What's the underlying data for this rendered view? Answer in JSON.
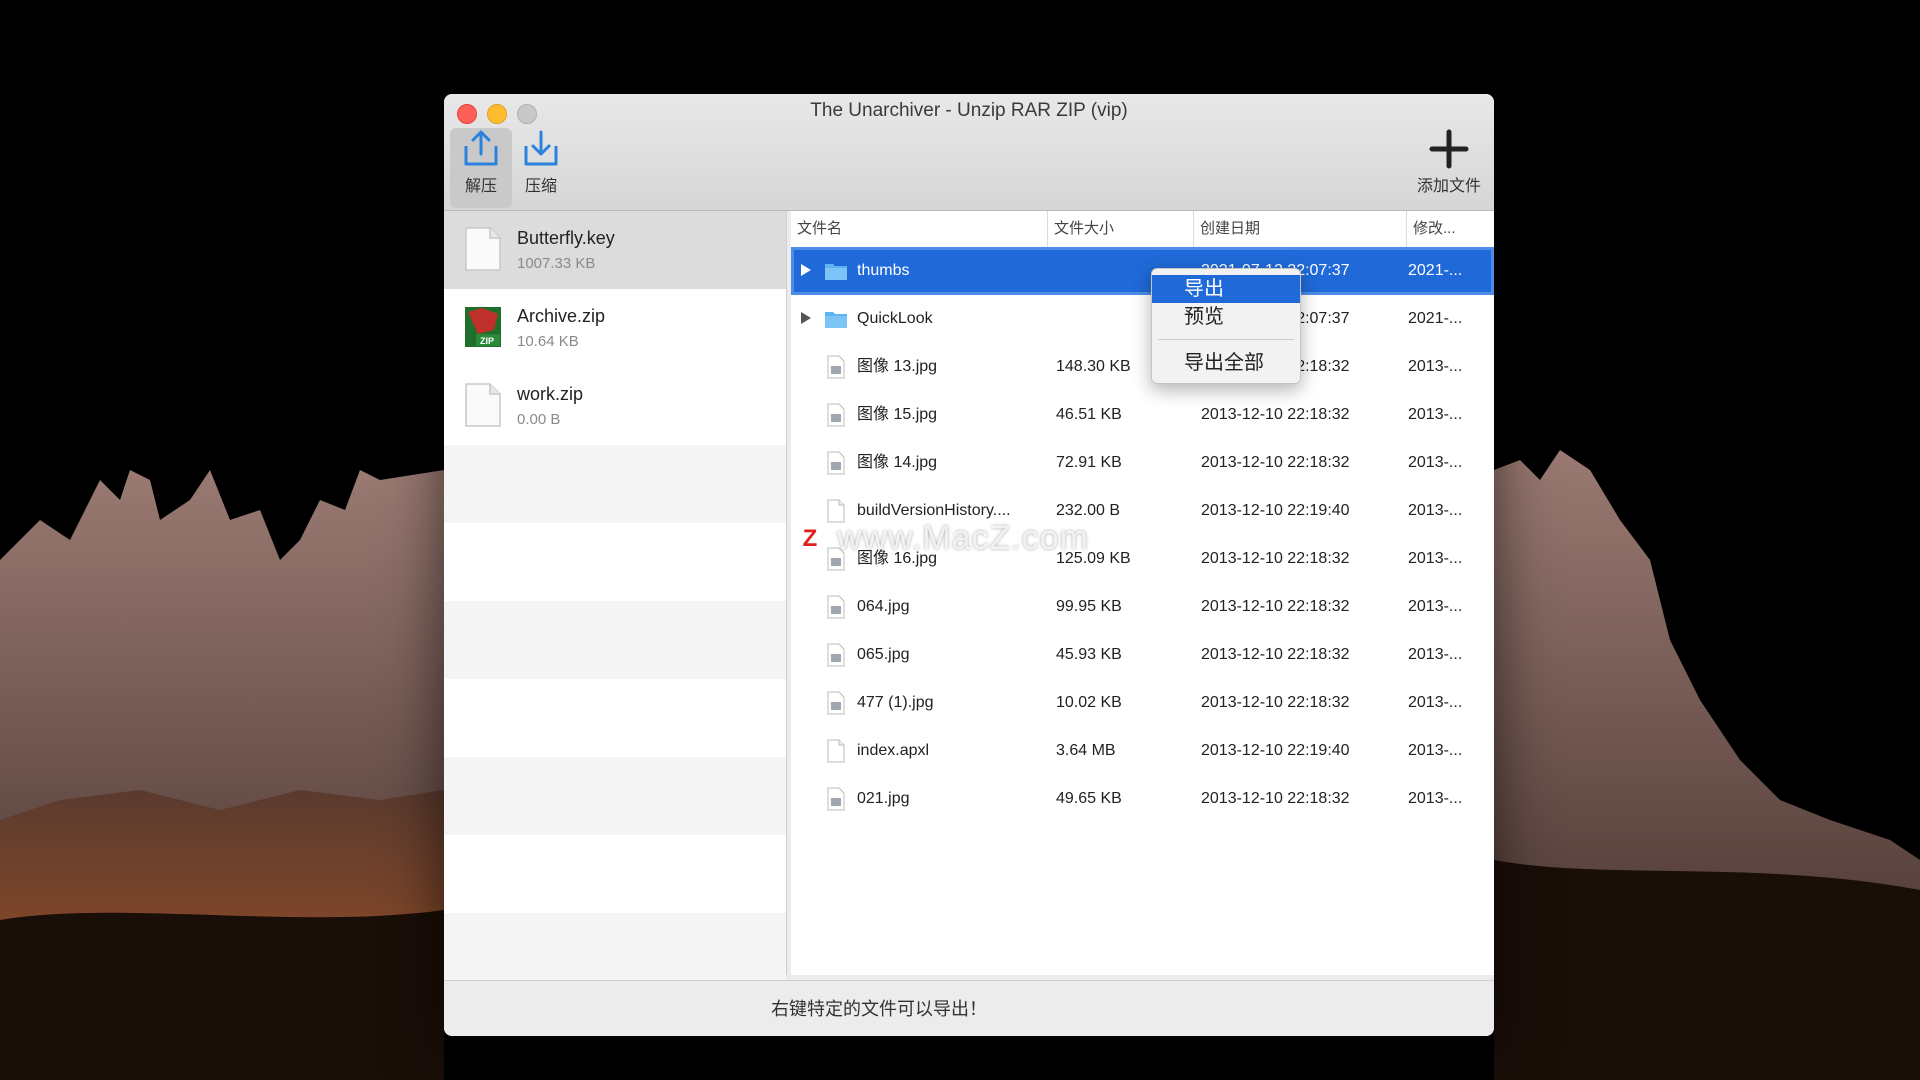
{
  "window": {
    "title": "The Unarchiver - Unzip RAR ZIP (vip)"
  },
  "toolbar": {
    "extract_label": "解压",
    "compress_label": "压缩",
    "add_label": "添加文件"
  },
  "sidebar": {
    "items": [
      {
        "name": "Butterfly.key",
        "size": "1007.33 KB",
        "icon": "document-icon"
      },
      {
        "name": "Archive.zip",
        "size": "10.64 KB",
        "icon": "zip-archive-icon"
      },
      {
        "name": "work.zip",
        "size": "0.00 B",
        "icon": "document-icon"
      }
    ]
  },
  "filelist": {
    "columns": [
      "文件名",
      "文件大小",
      "创建日期",
      "修改..."
    ],
    "rows": [
      {
        "name": "thumbs",
        "size": "",
        "created": "2021-07-12 22:07:37",
        "modified": "2021-...",
        "type": "folder"
      },
      {
        "name": "QuickLook",
        "size": "",
        "created": "2021-07-12 22:07:37",
        "modified": "2021-...",
        "type": "folder"
      },
      {
        "name": "图像 13.jpg",
        "size": "148.30 KB",
        "created": "2013-12-10 22:18:32",
        "modified": "2013-...",
        "type": "image"
      },
      {
        "name": "图像 15.jpg",
        "size": "46.51 KB",
        "created": "2013-12-10 22:18:32",
        "modified": "2013-...",
        "type": "image"
      },
      {
        "name": "图像 14.jpg",
        "size": "72.91 KB",
        "created": "2013-12-10 22:18:32",
        "modified": "2013-...",
        "type": "image"
      },
      {
        "name": "buildVersionHistory....",
        "size": "232.00 B",
        "created": "2013-12-10 22:19:40",
        "modified": "2013-...",
        "type": "file"
      },
      {
        "name": "图像 16.jpg",
        "size": "125.09 KB",
        "created": "2013-12-10 22:18:32",
        "modified": "2013-...",
        "type": "image"
      },
      {
        "name": "064.jpg",
        "size": "99.95 KB",
        "created": "2013-12-10 22:18:32",
        "modified": "2013-...",
        "type": "image"
      },
      {
        "name": "065.jpg",
        "size": "45.93 KB",
        "created": "2013-12-10 22:18:32",
        "modified": "2013-...",
        "type": "image"
      },
      {
        "name": "477 (1).jpg",
        "size": "10.02 KB",
        "created": "2013-12-10 22:18:32",
        "modified": "2013-...",
        "type": "image"
      },
      {
        "name": "index.apxl",
        "size": "3.64 MB",
        "created": "2013-12-10 22:19:40",
        "modified": "2013-...",
        "type": "file"
      },
      {
        "name": "021.jpg",
        "size": "49.65 KB",
        "created": "2013-12-10 22:18:32",
        "modified": "2013-...",
        "type": "image"
      }
    ]
  },
  "context_menu": {
    "items": [
      "导出",
      "预览",
      "导出全部"
    ]
  },
  "statusbar": {
    "text": "右键特定的文件可以导出！"
  },
  "watermark": {
    "badge": "Z",
    "text": "www.MacZ.com"
  },
  "colors": {
    "selection": "#1f69d8",
    "folder": "#5fb3f0"
  }
}
